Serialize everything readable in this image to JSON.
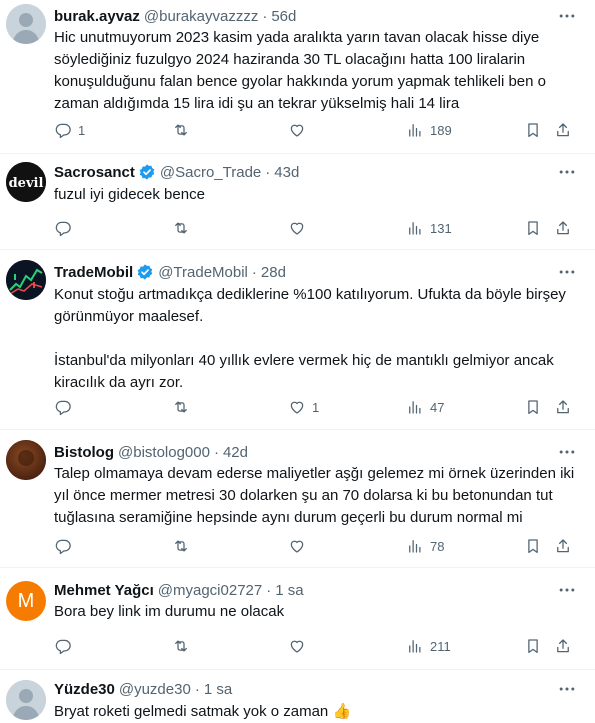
{
  "tweets": [
    {
      "name": "burak.ayvaz",
      "handle": "@burakayvazzzz",
      "time": "56d",
      "text": "Hic unutmuyorum 2023 kasim yada aralıkta yarın tavan olacak hisse diye söylediğiniz fuzulgyo 2024 haziranda 30 TL olacağını hatta 100 liralarin konuşulduğunu falan bence gyolar hakkında yorum yapmak tehlikeli ben o zaman aldığımda 15 lira idi şu an tekrar yükselmiş hali 14 lira",
      "replies": "1",
      "retweets": "",
      "likes": "",
      "views": "189",
      "verified": false
    },
    {
      "name": "Sacrosanct",
      "handle": "@Sacro_Trade",
      "time": "43d",
      "text": "fuzul iyi gidecek bence",
      "replies": "",
      "retweets": "",
      "likes": "",
      "views": "131",
      "verified": true,
      "avatar_text": "devil"
    },
    {
      "name": "TradeMobil",
      "handle": "@TradeMobil",
      "time": "28d",
      "text": "Konut stoğu artmadıkça dediklerine %100 katılıyorum. Ufukta da böyle birşey görünmüyor maalesef.\n\nİstanbul'da milyonları 40 yıllık evlere vermek hiç de mantıklı gelmiyor ancak kiracılık da ayrı zor.",
      "replies": "",
      "retweets": "",
      "likes": "1",
      "views": "47",
      "verified": true
    },
    {
      "name": "Bistolog",
      "handle": "@bistolog000",
      "time": "42d",
      "text": "Talep olmamaya devam ederse maliyetler aşğı gelemez mi örnek üzerinden iki yıl önce mermer metresi 30 dolarken şu an 70 dolarsa ki bu betonundan tut tuğlasına seramiğine hepsinde aynı durum geçerli bu durum normal mi",
      "replies": "",
      "retweets": "",
      "likes": "",
      "views": "78",
      "verified": false
    },
    {
      "name": "Mehmet Yağcı",
      "handle": "@myagci02727",
      "time": "1 sa",
      "text": "Bora bey link im durumu ne olacak",
      "replies": "",
      "retweets": "",
      "likes": "",
      "views": "211",
      "verified": false,
      "avatar_text": "M"
    },
    {
      "name": "Yüzde30",
      "handle": "@yuzde30",
      "time": "1 sa",
      "text": "Bryat roketi gelmedi satmak yok o zaman 👍",
      "replies": "",
      "retweets": "",
      "likes": "",
      "views": "",
      "verified": false
    }
  ],
  "colors": {
    "verified": "#1d9bf0",
    "muted": "#536471",
    "mehmet_avatar": "#f57c00"
  },
  "icons": [
    "reply-icon",
    "retweet-icon",
    "like-icon",
    "views-icon",
    "bookmark-icon",
    "share-icon",
    "more-icon",
    "verified-badge-icon"
  ]
}
